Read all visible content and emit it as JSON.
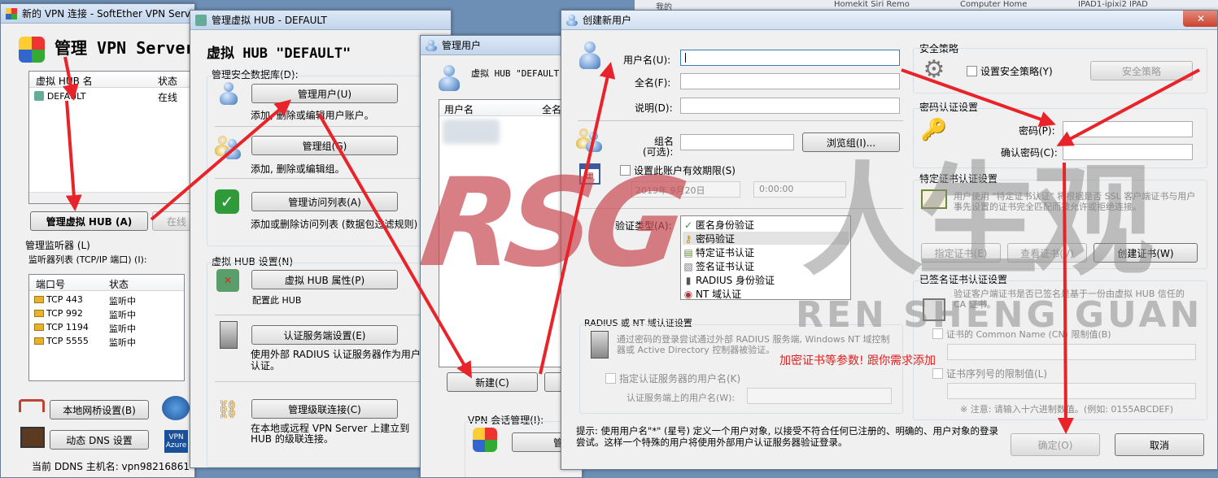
{
  "taskbar": {
    "items": [
      "我的",
      "Homekit Siri Remo",
      "Computer Home",
      "IPAD1-ipixi2 IPAD"
    ]
  },
  "main_window": {
    "title": "新的 VPN 连接 - SoftEther VPN Serv",
    "heading": "管理 VPN Server",
    "hub_list": {
      "headers": [
        "虚拟 HUB 名",
        "状态"
      ],
      "rows": [
        {
          "name": "DEFAULT",
          "status": "在线"
        }
      ]
    },
    "manage_hub_button": "管理虚拟 HUB (A)",
    "online_button": "在线",
    "listener_group": "管理监听器 (L)",
    "listener_list_label": "监听器列表 (TCP/IP 端口) (I):",
    "listener_headers": [
      "端口号",
      "状态"
    ],
    "listeners": [
      {
        "port": "TCP 443",
        "status": "监听中"
      },
      {
        "port": "TCP 992",
        "status": "监听中"
      },
      {
        "port": "TCP 1194",
        "status": "监听中"
      },
      {
        "port": "TCP 5555",
        "status": "监听中"
      }
    ],
    "local_bridge_button": "本地网桥设置(B)",
    "ddns_button": "动态 DNS 设置",
    "vpn_azure_label": "VPN Azure",
    "ddns_hostname": "当前 DDNS 主机名: vpn98216861"
  },
  "hub_window": {
    "title": "管理虚拟 HUB - DEFAULT",
    "heading": "虚拟 HUB \"DEFAULT\"",
    "security_section": "管理安全数据库(D):",
    "manage_users_button": "管理用户(U)",
    "manage_users_desc": "添加, 删除或编辑用户账户。",
    "manage_groups_button": "管理组(G)",
    "manage_groups_desc": "添加, 删除或编辑组。",
    "access_list_button": "管理访问列表(A)",
    "access_list_desc": "添加或删除访问列表 (数据包过滤规则)",
    "hub_settings_section": "虚拟 HUB 设置(N)",
    "hub_props_button": "虚拟 HUB 属性(P)",
    "hub_props_desc": "配置此 HUB",
    "auth_server_button": "认证服务端设置(E)",
    "auth_server_desc": "使用外部 RADIUS 认证服务器作为用户认证。",
    "cascade_button": "管理级联连接(C)",
    "cascade_desc": "在本地或远程 VPN Server 上建立到 HUB 的级联连接。"
  },
  "users_window": {
    "title": "管理用户",
    "hub_label": "虚拟 HUB \"DEFAULT\"",
    "headers": [
      "用户名",
      "全名"
    ],
    "new_button": "新建(C)",
    "session_label": "VPN 会话管理(I):",
    "session_button": "管"
  },
  "new_user_dialog": {
    "title": "创建新用户",
    "username_label": "用户名(U):",
    "username_value": "",
    "fullname_label": "全名(F):",
    "note_label": "说明(D):",
    "group_label1": "组名",
    "group_label2": "(可选):",
    "browse_group_button": "浏览组(I)...",
    "expiry_checkbox": "设置此账户有效期限(S)",
    "expiry_date": "2019年 9月20日",
    "expiry_time": "0:00:00",
    "auth_type_label": "验证类型(A):",
    "auth_types": [
      {
        "label": "匿名身份验证",
        "icon": "check-shield-icon"
      },
      {
        "label": "密码验证",
        "icon": "key-icon"
      },
      {
        "label": "特定证书认证",
        "icon": "certificate-icon"
      },
      {
        "label": "签名证书认证",
        "icon": "signed-cert-icon"
      },
      {
        "label": "RADIUS 身份验证",
        "icon": "server-icon"
      },
      {
        "label": "NT 域认证",
        "icon": "domain-icon"
      }
    ],
    "selected_auth": "密码验证",
    "radius_group": "RADIUS 或 NT 域认证设置",
    "radius_desc": "通过密码的登录尝试通过外部 RADIUS 服务端, Windows NT 域控制器或 Active Directory 控制器被验证。",
    "radius_user_checkbox": "指定认证服务器的用户名(K)",
    "radius_user_label": "认证服务端上的用户名(W):",
    "security_policy_group": "安全策略",
    "security_policy_checkbox": "设置安全策略(Y)",
    "security_policy_button": "安全策略",
    "password_group": "密码认证设置",
    "password_label": "密码(P):",
    "confirm_password_label": "确认密码(C):",
    "cert_group": "特定证书认证设置",
    "cert_desc": "用户使用 \"特定证书认证\" 将根据是否 SSL 客户端证书与用户事先设置的证书完全匹配而被允许或拒绝连接。",
    "specify_cert_button": "指定证书(E)",
    "view_cert_button": "查看证书(V)",
    "create_cert_button": "创建证书(W)",
    "signed_group": "已签名证书认证设置",
    "signed_desc": "验证客户端证书是否已签名是基于一份由虚拟 HUB 信任的 CA 证书。",
    "cn_checkbox": "证书的 Common Name (CN) 限制值(B)",
    "serial_checkbox": "证书序列号的限制值(L)",
    "hex_note": "※ 注意: 请输入十六进制数值。(例如: 0155ABCDEF)",
    "annotation": "加密证书等参数! 跟你需求添加",
    "tip": "提示: 使用用户名\"*\" (星号) 定义一个用户对象, 以接受不符合任何已注册的、明确的、用户对象的登录尝试。这样一个特殊的用户将使用外部用户认证服务器验证登录。",
    "ok_button": "确定(O)",
    "cancel_button": "取消"
  },
  "watermark": {
    "logo": "RSG",
    "chinese": "人生观",
    "pinyin": "REN SHENG GUAN"
  },
  "colors": {
    "arrow": "#e8242a",
    "watermark": "#c84a52",
    "annotation": "#e02020",
    "title_bar": "#c3d5ec"
  }
}
